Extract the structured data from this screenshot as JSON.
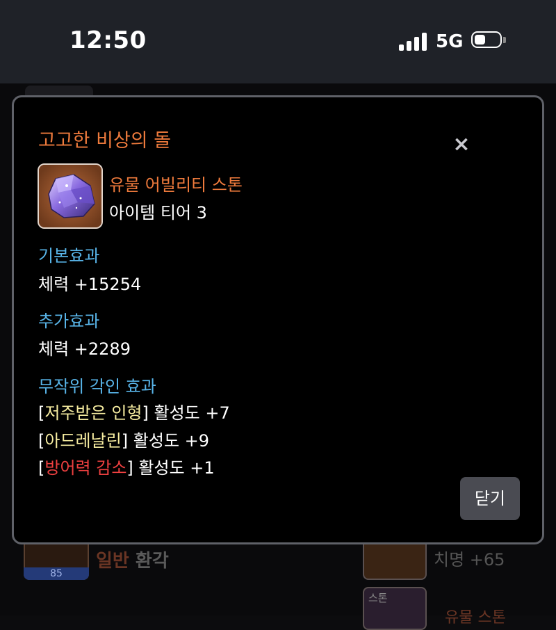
{
  "status_bar": {
    "time": "12:50",
    "network": "5G"
  },
  "background": {
    "item_level": "85",
    "item_grade": "일반",
    "item_name": "환각",
    "stat_text": "치명 +65",
    "stone_label": "스톤",
    "stone_name": "유물 스톤"
  },
  "modal": {
    "title": "고고한 비상의 돌",
    "close_symbol": "×",
    "item": {
      "icon": "purple-crystal-stone-icon",
      "grade_type": "유물 어빌리티 스톤",
      "tier": "아이템 티어 3"
    },
    "base_effect": {
      "label": "기본효과",
      "value": "체력 +15254"
    },
    "extra_effect": {
      "label": "추가효과",
      "value": "체력 +2289"
    },
    "random_engraving": {
      "label": "무작위 각인 효과",
      "effects": [
        {
          "name": "저주받은 인형",
          "activity": "활성도 +7",
          "color": "#f6eca0"
        },
        {
          "name": "아드레날린",
          "activity": "활성도 +9",
          "color": "#f6eca0"
        },
        {
          "name": "방어력 감소",
          "activity": "활성도 +1",
          "color": "#ee4040"
        }
      ]
    },
    "confirm_label": "닫기"
  },
  "colors": {
    "title_orange": "#ee7a3c",
    "section_blue": "#58b4e8",
    "positive_engrave": "#f6eca0",
    "negative_engrave": "#ee4040",
    "button_bg": "#4a4b52"
  }
}
